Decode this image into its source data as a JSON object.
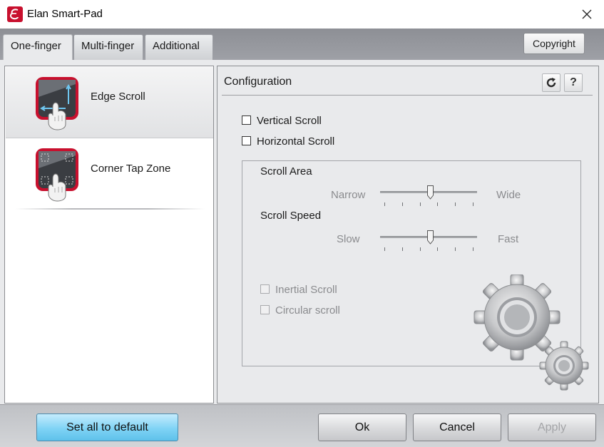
{
  "window": {
    "title": "Elan Smart-Pad",
    "app_icon": "elan-logo-icon",
    "close_icon": "close-icon"
  },
  "tabs": [
    {
      "label": "One-finger",
      "active": true
    },
    {
      "label": "Multi-finger",
      "active": false
    },
    {
      "label": "Additional",
      "active": false
    }
  ],
  "copyright_label": "Copyright",
  "feature_list": [
    {
      "label": "Edge Scroll",
      "icon": "edge-scroll-icon",
      "selected": true
    },
    {
      "label": "Corner Tap Zone",
      "icon": "corner-tap-zone-icon",
      "selected": false
    }
  ],
  "config": {
    "title": "Configuration",
    "refresh_icon": "refresh-icon",
    "help_label": "?",
    "vertical_scroll": {
      "label": "Vertical Scroll",
      "checked": false
    },
    "horizontal_scroll": {
      "label": "Horizontal Scroll",
      "checked": false
    },
    "scroll_area": {
      "label": "Scroll Area",
      "min_label": "Narrow",
      "max_label": "Wide",
      "level": 0.5
    },
    "scroll_speed": {
      "label": "Scroll Speed",
      "min_label": "Slow",
      "max_label": "Fast",
      "level": 0.5
    },
    "inertial_scroll": {
      "label": "Inertial Scroll",
      "checked": false,
      "enabled": false
    },
    "circular_scroll": {
      "label": "Circular scroll",
      "checked": false,
      "enabled": false
    },
    "decoration": "gears-icon"
  },
  "buttons": {
    "set_default": "Set all to default",
    "ok": "Ok",
    "cancel": "Cancel",
    "apply": "Apply"
  },
  "colors": {
    "accent_blue": "#7fd3f5",
    "brand_red": "#c8102e"
  }
}
